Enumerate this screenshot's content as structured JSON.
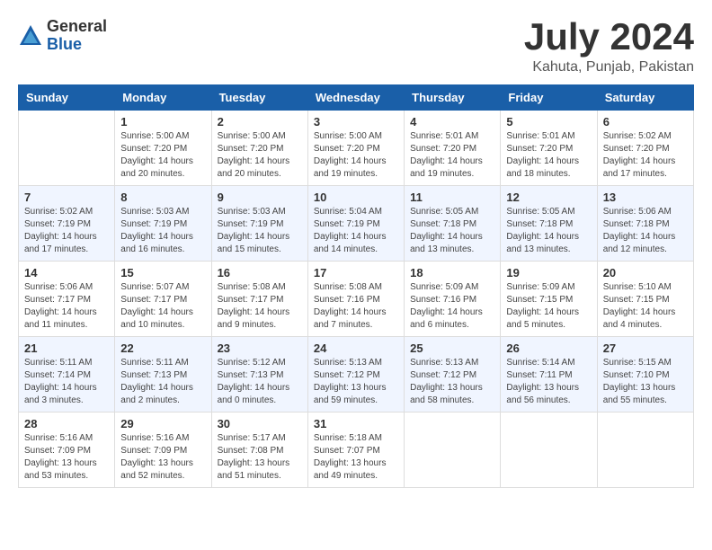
{
  "header": {
    "logo_general": "General",
    "logo_blue": "Blue",
    "month_title": "July 2024",
    "location": "Kahuta, Punjab, Pakistan"
  },
  "days_of_week": [
    "Sunday",
    "Monday",
    "Tuesday",
    "Wednesday",
    "Thursday",
    "Friday",
    "Saturday"
  ],
  "weeks": [
    [
      {
        "day": "",
        "sunrise": "",
        "sunset": "",
        "daylight": ""
      },
      {
        "day": "1",
        "sunrise": "Sunrise: 5:00 AM",
        "sunset": "Sunset: 7:20 PM",
        "daylight": "Daylight: 14 hours and 20 minutes."
      },
      {
        "day": "2",
        "sunrise": "Sunrise: 5:00 AM",
        "sunset": "Sunset: 7:20 PM",
        "daylight": "Daylight: 14 hours and 20 minutes."
      },
      {
        "day": "3",
        "sunrise": "Sunrise: 5:00 AM",
        "sunset": "Sunset: 7:20 PM",
        "daylight": "Daylight: 14 hours and 19 minutes."
      },
      {
        "day": "4",
        "sunrise": "Sunrise: 5:01 AM",
        "sunset": "Sunset: 7:20 PM",
        "daylight": "Daylight: 14 hours and 19 minutes."
      },
      {
        "day": "5",
        "sunrise": "Sunrise: 5:01 AM",
        "sunset": "Sunset: 7:20 PM",
        "daylight": "Daylight: 14 hours and 18 minutes."
      },
      {
        "day": "6",
        "sunrise": "Sunrise: 5:02 AM",
        "sunset": "Sunset: 7:20 PM",
        "daylight": "Daylight: 14 hours and 17 minutes."
      }
    ],
    [
      {
        "day": "7",
        "sunrise": "Sunrise: 5:02 AM",
        "sunset": "Sunset: 7:19 PM",
        "daylight": "Daylight: 14 hours and 17 minutes."
      },
      {
        "day": "8",
        "sunrise": "Sunrise: 5:03 AM",
        "sunset": "Sunset: 7:19 PM",
        "daylight": "Daylight: 14 hours and 16 minutes."
      },
      {
        "day": "9",
        "sunrise": "Sunrise: 5:03 AM",
        "sunset": "Sunset: 7:19 PM",
        "daylight": "Daylight: 14 hours and 15 minutes."
      },
      {
        "day": "10",
        "sunrise": "Sunrise: 5:04 AM",
        "sunset": "Sunset: 7:19 PM",
        "daylight": "Daylight: 14 hours and 14 minutes."
      },
      {
        "day": "11",
        "sunrise": "Sunrise: 5:05 AM",
        "sunset": "Sunset: 7:18 PM",
        "daylight": "Daylight: 14 hours and 13 minutes."
      },
      {
        "day": "12",
        "sunrise": "Sunrise: 5:05 AM",
        "sunset": "Sunset: 7:18 PM",
        "daylight": "Daylight: 14 hours and 13 minutes."
      },
      {
        "day": "13",
        "sunrise": "Sunrise: 5:06 AM",
        "sunset": "Sunset: 7:18 PM",
        "daylight": "Daylight: 14 hours and 12 minutes."
      }
    ],
    [
      {
        "day": "14",
        "sunrise": "Sunrise: 5:06 AM",
        "sunset": "Sunset: 7:17 PM",
        "daylight": "Daylight: 14 hours and 11 minutes."
      },
      {
        "day": "15",
        "sunrise": "Sunrise: 5:07 AM",
        "sunset": "Sunset: 7:17 PM",
        "daylight": "Daylight: 14 hours and 10 minutes."
      },
      {
        "day": "16",
        "sunrise": "Sunrise: 5:08 AM",
        "sunset": "Sunset: 7:17 PM",
        "daylight": "Daylight: 14 hours and 9 minutes."
      },
      {
        "day": "17",
        "sunrise": "Sunrise: 5:08 AM",
        "sunset": "Sunset: 7:16 PM",
        "daylight": "Daylight: 14 hours and 7 minutes."
      },
      {
        "day": "18",
        "sunrise": "Sunrise: 5:09 AM",
        "sunset": "Sunset: 7:16 PM",
        "daylight": "Daylight: 14 hours and 6 minutes."
      },
      {
        "day": "19",
        "sunrise": "Sunrise: 5:09 AM",
        "sunset": "Sunset: 7:15 PM",
        "daylight": "Daylight: 14 hours and 5 minutes."
      },
      {
        "day": "20",
        "sunrise": "Sunrise: 5:10 AM",
        "sunset": "Sunset: 7:15 PM",
        "daylight": "Daylight: 14 hours and 4 minutes."
      }
    ],
    [
      {
        "day": "21",
        "sunrise": "Sunrise: 5:11 AM",
        "sunset": "Sunset: 7:14 PM",
        "daylight": "Daylight: 14 hours and 3 minutes."
      },
      {
        "day": "22",
        "sunrise": "Sunrise: 5:11 AM",
        "sunset": "Sunset: 7:13 PM",
        "daylight": "Daylight: 14 hours and 2 minutes."
      },
      {
        "day": "23",
        "sunrise": "Sunrise: 5:12 AM",
        "sunset": "Sunset: 7:13 PM",
        "daylight": "Daylight: 14 hours and 0 minutes."
      },
      {
        "day": "24",
        "sunrise": "Sunrise: 5:13 AM",
        "sunset": "Sunset: 7:12 PM",
        "daylight": "Daylight: 13 hours and 59 minutes."
      },
      {
        "day": "25",
        "sunrise": "Sunrise: 5:13 AM",
        "sunset": "Sunset: 7:12 PM",
        "daylight": "Daylight: 13 hours and 58 minutes."
      },
      {
        "day": "26",
        "sunrise": "Sunrise: 5:14 AM",
        "sunset": "Sunset: 7:11 PM",
        "daylight": "Daylight: 13 hours and 56 minutes."
      },
      {
        "day": "27",
        "sunrise": "Sunrise: 5:15 AM",
        "sunset": "Sunset: 7:10 PM",
        "daylight": "Daylight: 13 hours and 55 minutes."
      }
    ],
    [
      {
        "day": "28",
        "sunrise": "Sunrise: 5:16 AM",
        "sunset": "Sunset: 7:09 PM",
        "daylight": "Daylight: 13 hours and 53 minutes."
      },
      {
        "day": "29",
        "sunrise": "Sunrise: 5:16 AM",
        "sunset": "Sunset: 7:09 PM",
        "daylight": "Daylight: 13 hours and 52 minutes."
      },
      {
        "day": "30",
        "sunrise": "Sunrise: 5:17 AM",
        "sunset": "Sunset: 7:08 PM",
        "daylight": "Daylight: 13 hours and 51 minutes."
      },
      {
        "day": "31",
        "sunrise": "Sunrise: 5:18 AM",
        "sunset": "Sunset: 7:07 PM",
        "daylight": "Daylight: 13 hours and 49 minutes."
      },
      {
        "day": "",
        "sunrise": "",
        "sunset": "",
        "daylight": ""
      },
      {
        "day": "",
        "sunrise": "",
        "sunset": "",
        "daylight": ""
      },
      {
        "day": "",
        "sunrise": "",
        "sunset": "",
        "daylight": ""
      }
    ]
  ]
}
